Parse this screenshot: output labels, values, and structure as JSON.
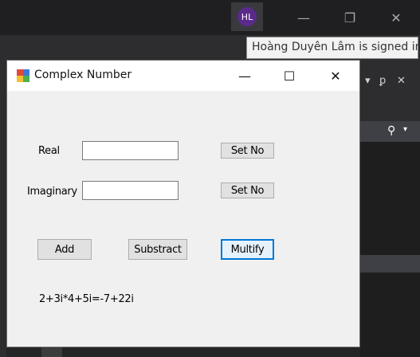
{
  "ide": {
    "user_initials": "HL",
    "tooltip": "Hoàng Duyên Lâm is signed in",
    "minimize_icon": "minimize-icon",
    "restore_icon": "restore-icon",
    "close_icon": "close-icon"
  },
  "window": {
    "title": "Complex Number",
    "minimize": "—",
    "maximize": "☐",
    "close": "✕"
  },
  "form": {
    "real_label": "Real",
    "imaginary_label": "Imaginary",
    "real_value": "",
    "imaginary_value": "",
    "set_real_button": "Set No",
    "set_imaginary_button": "Set No",
    "add_button": "Add",
    "subtract_button": "Substract",
    "multiply_button": "Multify",
    "result_text": "2+3i*4+5i=-7+22i"
  }
}
